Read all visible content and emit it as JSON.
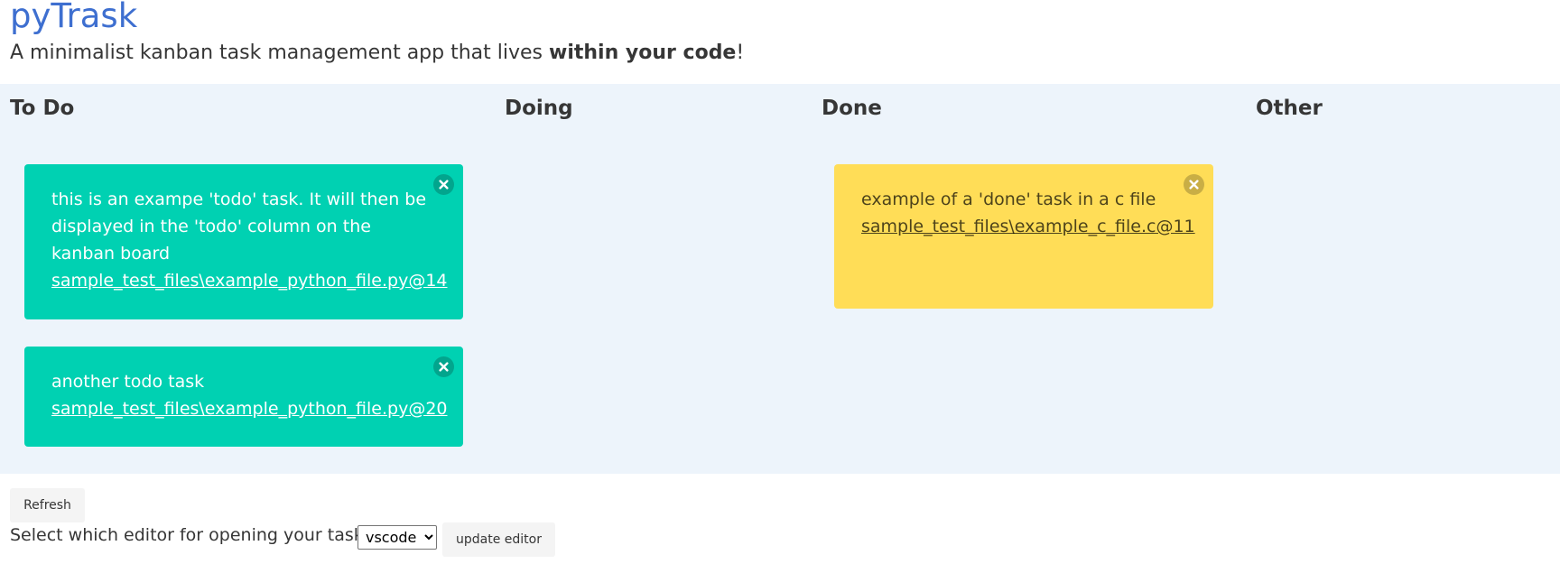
{
  "header": {
    "title": "pyTrask",
    "subtitle_before": "A minimalist kanban task management app that lives ",
    "subtitle_bold": "within your code",
    "subtitle_after": "!"
  },
  "columns": [
    {
      "name": "To Do"
    },
    {
      "name": "Doing"
    },
    {
      "name": "Done"
    },
    {
      "name": "Other"
    }
  ],
  "cards": {
    "todo_1": {
      "text": "this is an exampe 'todo' task. It will then be displayed in the 'todo' column on the kanban board",
      "link": "sample_test_files\\example_python_file.py@14"
    },
    "todo_2": {
      "text": "another todo task",
      "link": "sample_test_files\\example_python_file.py@20"
    },
    "done_1": {
      "text": "example of a 'done' task in a c file",
      "link": "sample_test_files\\example_c_file.c@11"
    }
  },
  "colors": {
    "title": "#3e6fd0",
    "todo_card": "#00d1b2",
    "done_card": "#ffdd57",
    "board_bg": "#edf4fb"
  },
  "controls": {
    "refresh_label": "Refresh",
    "editor_prompt": "Select which editor for opening your tasks:",
    "editor_options": [
      "vscode"
    ],
    "editor_selected": "vscode",
    "update_label": "update editor"
  }
}
